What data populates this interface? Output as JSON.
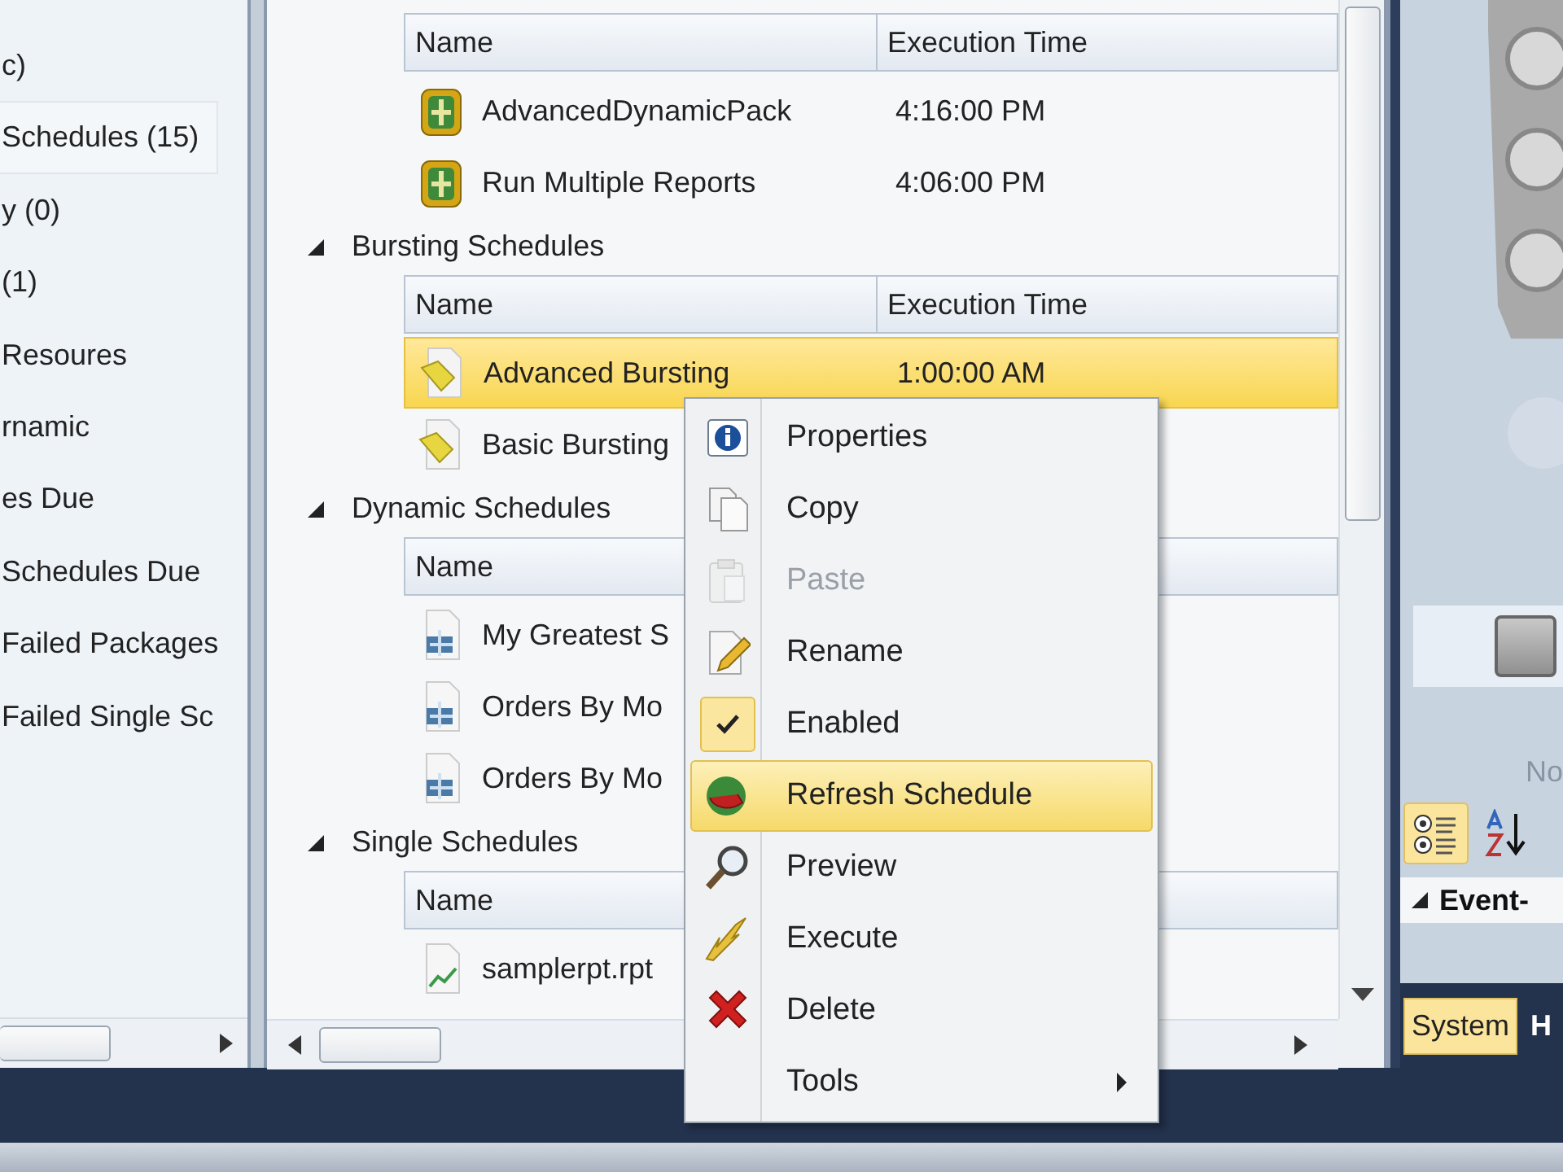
{
  "sidebar": {
    "items": [
      {
        "label": "c)",
        "selected": false
      },
      {
        "label": "Schedules (15)",
        "selected": true
      },
      {
        "label": "y (0)",
        "selected": false
      },
      {
        "label": "(1)",
        "selected": false
      },
      {
        "label": "Resoures",
        "selected": false
      },
      {
        "label": "rnamic",
        "selected": false
      },
      {
        "label": "es Due",
        "selected": false
      },
      {
        "label": "Schedules Due",
        "selected": false
      },
      {
        "label": "Failed Packages",
        "selected": false
      },
      {
        "label": "Failed Single Sc",
        "selected": false
      }
    ]
  },
  "schedule_groups": [
    {
      "columns": [
        "Name",
        "Execution Time"
      ],
      "rows": [
        {
          "name": "AdvancedDynamicPack",
          "time": "4:16:00 PM",
          "kind": "package",
          "selected": false
        },
        {
          "name": "Run Multiple Reports",
          "time": "4:06:00 PM",
          "kind": "package",
          "selected": false
        }
      ]
    },
    {
      "title": "Bursting Schedules",
      "columns": [
        "Name",
        "Execution Time"
      ],
      "rows": [
        {
          "name": "Advanced Bursting",
          "time": "1:00:00 AM",
          "kind": "bursting",
          "selected": true
        },
        {
          "name": "Basic Bursting",
          "kind": "bursting",
          "selected": false
        }
      ]
    },
    {
      "title": "Dynamic Schedules",
      "columns": [
        "Name"
      ],
      "rows": [
        {
          "name": "My Greatest S",
          "kind": "dynamic",
          "selected": false
        },
        {
          "name": "Orders By Mo",
          "kind": "dynamic",
          "selected": false
        },
        {
          "name": "Orders By Mo",
          "kind": "dynamic",
          "selected": false
        }
      ]
    },
    {
      "title": "Single Schedules",
      "columns": [
        "Name"
      ],
      "rows": [
        {
          "name": "samplerpt.rpt",
          "kind": "report",
          "selected": false
        }
      ]
    }
  ],
  "context_menu": {
    "items": [
      {
        "label": "Properties",
        "kind": "info",
        "disabled": false,
        "checked": false,
        "selected": false
      },
      {
        "label": "Copy",
        "kind": "copy",
        "disabled": false,
        "checked": false,
        "selected": false
      },
      {
        "label": "Paste",
        "kind": "paste",
        "disabled": true,
        "checked": false,
        "selected": false
      },
      {
        "label": "Rename",
        "kind": "rename",
        "disabled": false,
        "checked": false,
        "selected": false
      },
      {
        "label": "Enabled",
        "kind": "check",
        "disabled": false,
        "checked": true,
        "selected": false
      },
      {
        "label": "Refresh Schedule",
        "kind": "refresh",
        "disabled": false,
        "checked": false,
        "selected": true
      },
      {
        "label": "Preview",
        "kind": "preview",
        "disabled": false,
        "checked": false,
        "selected": false
      },
      {
        "label": "Execute",
        "kind": "execute",
        "disabled": false,
        "checked": false,
        "selected": false
      },
      {
        "label": "Delete",
        "kind": "delete",
        "disabled": false,
        "checked": false,
        "selected": false
      },
      {
        "label": "Tools",
        "kind": "tools",
        "submenu": true,
        "disabled": false,
        "checked": false,
        "selected": false
      }
    ]
  },
  "right_panel": {
    "caption": "No",
    "toolbar": [
      {
        "kind": "categorized",
        "selected": true
      },
      {
        "kind": "alphabetical",
        "selected": false
      }
    ],
    "section": "Event-",
    "tabs": [
      {
        "label": "System",
        "selected": true
      },
      {
        "label": "H",
        "selected": false
      }
    ]
  }
}
